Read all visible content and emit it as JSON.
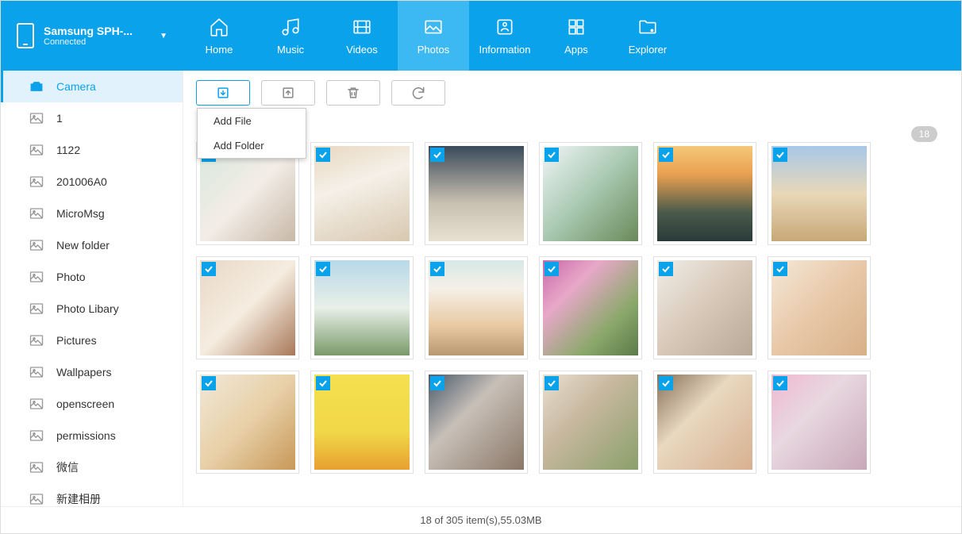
{
  "device": {
    "name": "Samsung SPH-...",
    "status": "Connected"
  },
  "nav": {
    "home": "Home",
    "music": "Music",
    "videos": "Videos",
    "photos": "Photos",
    "information": "Information",
    "apps": "Apps",
    "explorer": "Explorer"
  },
  "sidebar": {
    "items": [
      {
        "label": "Camera"
      },
      {
        "label": "1"
      },
      {
        "label": "1122"
      },
      {
        "label": "201006A0"
      },
      {
        "label": "MicroMsg"
      },
      {
        "label": "New folder"
      },
      {
        "label": "Photo"
      },
      {
        "label": "Photo Libary"
      },
      {
        "label": "Pictures"
      },
      {
        "label": "Wallpapers"
      },
      {
        "label": "openscreen"
      },
      {
        "label": "permissions"
      },
      {
        "label": "微信"
      },
      {
        "label": "新建相册"
      }
    ]
  },
  "toolbar": {
    "dropdown": {
      "add_file": "Add File",
      "add_folder": "Add Folder"
    }
  },
  "badge": "18",
  "thumbnails": [
    {
      "checked": true
    },
    {
      "checked": true
    },
    {
      "checked": true
    },
    {
      "checked": true
    },
    {
      "checked": true
    },
    {
      "checked": true
    },
    {
      "checked": true
    },
    {
      "checked": true
    },
    {
      "checked": true
    },
    {
      "checked": true
    },
    {
      "checked": true
    },
    {
      "checked": true
    },
    {
      "checked": true
    },
    {
      "checked": true
    },
    {
      "checked": true
    },
    {
      "checked": true
    },
    {
      "checked": true
    },
    {
      "checked": true
    }
  ],
  "footer": "18 of 305 item(s),55.03MB"
}
